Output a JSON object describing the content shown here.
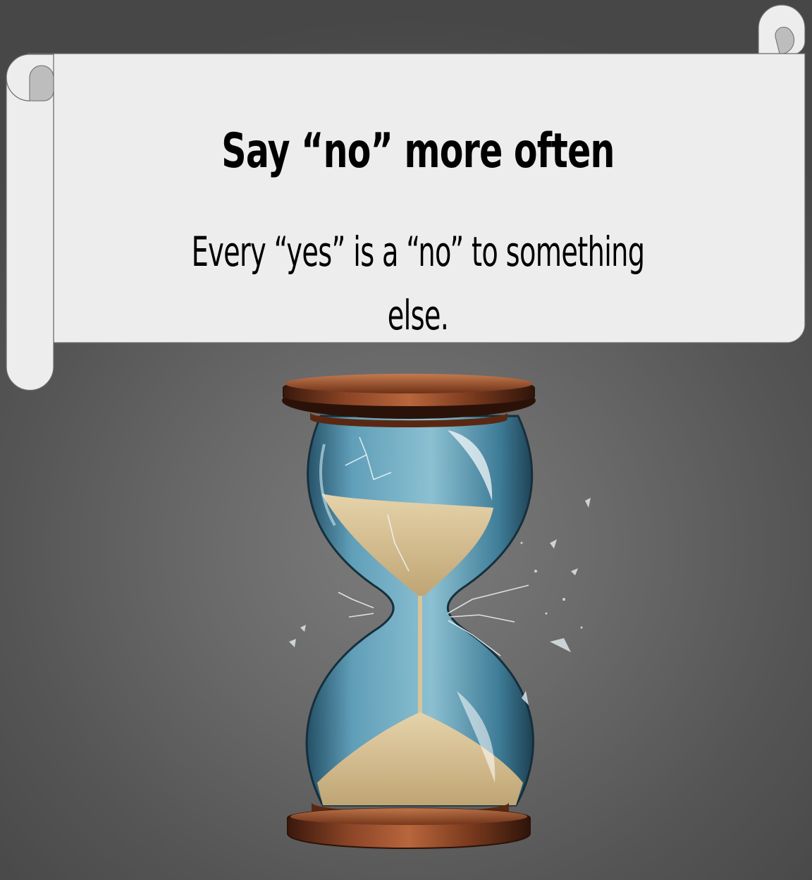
{
  "banner": {
    "title": "Say “no” more often",
    "subtitle": "Every “yes” is a “no” to something else."
  },
  "illustration": {
    "subject": "hourglass-icon",
    "colors": {
      "frame_wood": "#7a3a1e",
      "glass": "#5fa3bf",
      "sand": "#d9c49a"
    }
  },
  "colors": {
    "background": "#5a5a5a",
    "scroll_paper": "#ededed",
    "scroll_curl": "#bdbdbd",
    "text": "#000000"
  }
}
